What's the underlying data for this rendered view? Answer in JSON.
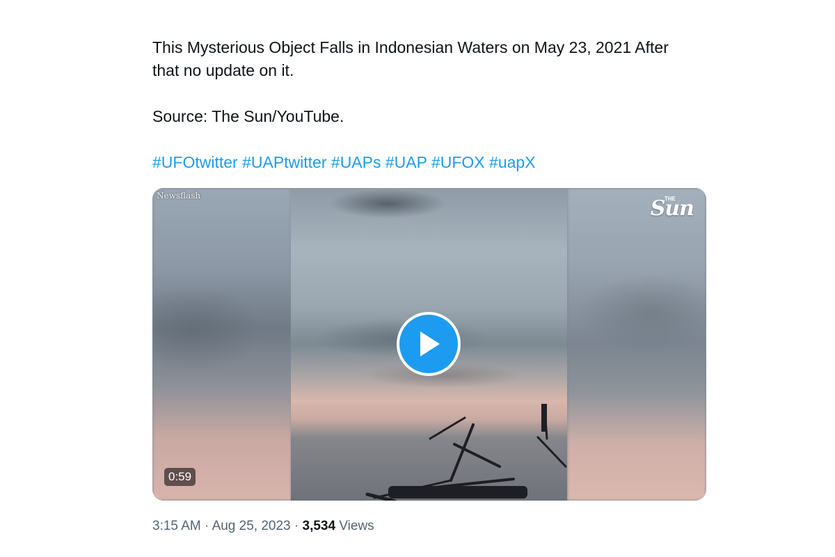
{
  "tweet": {
    "line1": "This Mysterious Object Falls in Indonesian Waters on May 23, 2021 After",
    "line2": "that no update on it.",
    "source": "Source: The Sun/YouTube.",
    "hashtags": [
      "#UFOtwitter",
      "#UAPtwitter",
      "#UAPs",
      "#UAP",
      "#UFOX",
      "#uapX"
    ]
  },
  "media": {
    "watermark_left": "Newsflash",
    "logo_the": "THE",
    "logo_sun": "Sun",
    "duration": "0:59",
    "play_color": "#1d9bf0"
  },
  "meta": {
    "time": "3:15 AM",
    "separator": "·",
    "date": "Aug 25, 2023",
    "views_count": "3,534",
    "views_label": "Views"
  },
  "colors": {
    "link": "#1d9bf0",
    "text": "#0f1419",
    "secondary": "#536471"
  }
}
